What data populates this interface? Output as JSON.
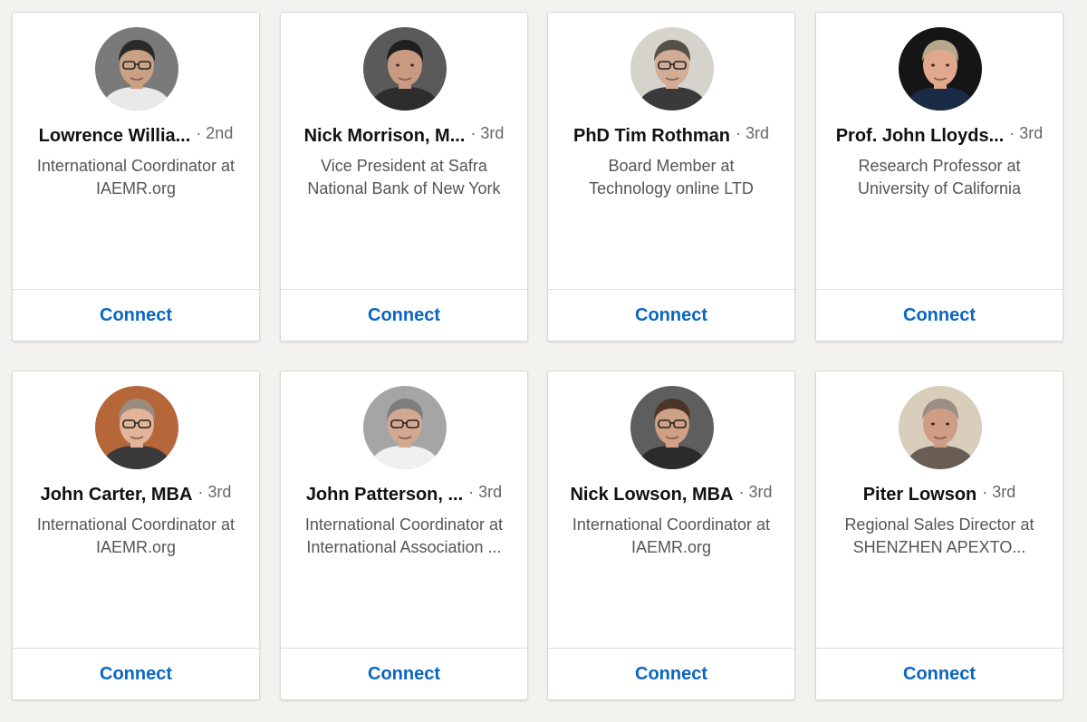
{
  "colors": {
    "accent": "#0a66c2",
    "page_background": "#f3f2ef",
    "card_background": "#ffffff"
  },
  "cards": [
    {
      "name": "Lowrence Willia...",
      "degree": "· 2nd",
      "headline": [
        "International Coordinator at",
        "IAEMR.org"
      ],
      "connect_label": "Connect",
      "photo": {
        "bg": "#7a7a7a",
        "skin": "#c9a184",
        "hair": "#2a2a2a",
        "shirt": "#e9e9e9",
        "glasses": true
      }
    },
    {
      "name": "Nick Morrison, M...",
      "degree": "· 3rd",
      "headline": [
        "Vice President at Safra",
        "National Bank of New York"
      ],
      "connect_label": "Connect",
      "photo": {
        "bg": "#5a5a5a",
        "skin": "#c89a82",
        "hair": "#1f1f1f",
        "shirt": "#2d2d2d",
        "glasses": false
      }
    },
    {
      "name": "PhD Tim Rothman",
      "degree": "· 3rd",
      "headline": [
        "Board Member at",
        "Technology online LTD"
      ],
      "connect_label": "Connect",
      "photo": {
        "bg": "#d6d3cd",
        "skin": "#d2ad95",
        "hair": "#555048",
        "shirt": "#3a3a3a",
        "glasses": true
      }
    },
    {
      "name": "Prof. John Lloyds...",
      "degree": "· 3rd",
      "headline": [
        "Research Professor at",
        "University of California"
      ],
      "connect_label": "Connect",
      "photo": {
        "bg": "#151515",
        "skin": "#e0a98e",
        "hair": "#b8a88a",
        "shirt": "#1b2a45",
        "glasses": false
      }
    },
    {
      "name": "John Carter, MBA",
      "degree": "· 3rd",
      "headline": [
        "International Coordinator at",
        "IAEMR.org"
      ],
      "connect_label": "Connect",
      "photo": {
        "bg": "#b6673a",
        "skin": "#e3b49a",
        "hair": "#9a8d7e",
        "shirt": "#3a3a3a",
        "glasses": true
      }
    },
    {
      "name": "John Patterson, ...",
      "degree": "· 3rd",
      "headline": [
        "International Coordinator at",
        "International Association ..."
      ],
      "connect_label": "Connect",
      "photo": {
        "bg": "#a5a5a5",
        "skin": "#d3a890",
        "hair": "#7d7d7d",
        "shirt": "#f0f0f0",
        "glasses": true
      }
    },
    {
      "name": "Nick Lowson, MBA",
      "degree": "· 3rd",
      "headline": [
        "International Coordinator at",
        "IAEMR.org"
      ],
      "connect_label": "Connect",
      "photo": {
        "bg": "#5e5e5e",
        "skin": "#cf9f86",
        "hair": "#4a3526",
        "shirt": "#2b2b2b",
        "glasses": true
      }
    },
    {
      "name": "Piter Lowson",
      "degree": "· 3rd",
      "headline": [
        "Regional Sales Director at",
        "SHENZHEN APEXTO..."
      ],
      "connect_label": "Connect",
      "photo": {
        "bg": "#d9cdbb",
        "skin": "#cf9c86",
        "hair": "#9a8e85",
        "shirt": "#6a5d54",
        "glasses": false
      }
    }
  ]
}
